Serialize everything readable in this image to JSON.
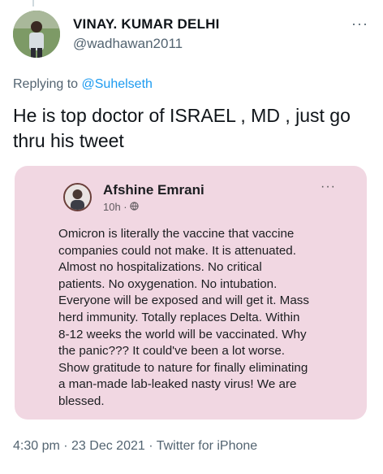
{
  "tweet": {
    "author_name": "VINAY. KUMAR DELHI",
    "author_handle": "@wadhawan2011",
    "more_icon": "more-horizontal-icon",
    "replying_prefix": "Replying to",
    "replying_to": "@Suhelseth",
    "text": "He is top doctor of ISRAEL , MD , just go thru his tweet",
    "timestamp": "4:30 pm · 23 Dec 2021 · Twitter for iPhone"
  },
  "embedded_post": {
    "author_name": "Afshine Emrani",
    "time": "10h ·",
    "audience_icon": "globe-icon",
    "more_icon": "more-horizontal-icon",
    "body": "Omicron is literally the vaccine that vaccine\ncompanies could not make.  It is attenuated.\nAlmost no hospitalizations.  No critical\npatients.  No oxygenation.  No intubation.\nEveryone will be exposed and will get it.  Mass\nherd immunity.  Totally replaces Delta.  Within\n8-12 weeks the world will be vaccinated.  Why\nthe panic???  It could've been a lot worse.\nShow gratitude to nature for finally eliminating\na man-made lab-leaked nasty virus!  We are\nblessed."
  },
  "colors": {
    "link": "#1d9bf0",
    "secondary_text": "#536471",
    "embed_background": "#f1d7e2"
  }
}
